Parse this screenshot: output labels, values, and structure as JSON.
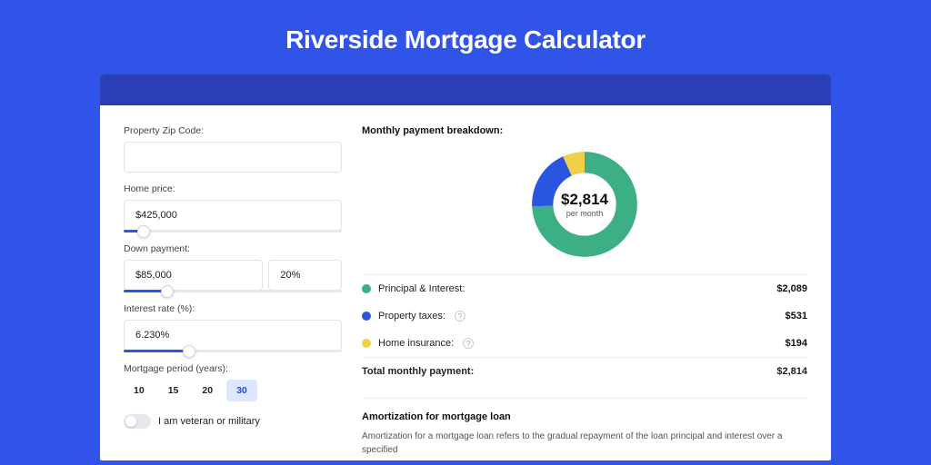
{
  "title": "Riverside Mortgage Calculator",
  "form": {
    "zip": {
      "label": "Property Zip Code:",
      "value": ""
    },
    "home_price": {
      "label": "Home price:",
      "value": "$425,000",
      "slider_pct": 9
    },
    "down_payment": {
      "label": "Down payment:",
      "amount": "$85,000",
      "percent": "20%",
      "slider_pct": 20
    },
    "interest": {
      "label": "Interest rate (%):",
      "value": "6.230%",
      "slider_pct": 30
    },
    "period": {
      "label": "Mortgage period (years):",
      "options": [
        "10",
        "15",
        "20",
        "30"
      ],
      "selected": "30"
    },
    "veteran": {
      "label": "I am veteran or military",
      "value": false
    }
  },
  "breakdown": {
    "title": "Monthly payment breakdown:",
    "center_amount": "$2,814",
    "center_sub": "per month",
    "items": [
      {
        "label": "Principal & Interest:",
        "value": "$2,089",
        "color": "g",
        "info": false
      },
      {
        "label": "Property taxes:",
        "value": "$531",
        "color": "b",
        "info": true
      },
      {
        "label": "Home insurance:",
        "value": "$194",
        "color": "y",
        "info": true
      }
    ],
    "total_label": "Total monthly payment:",
    "total_value": "$2,814"
  },
  "amort": {
    "title": "Amortization for mortgage loan",
    "text": "Amortization for a mortgage loan refers to the gradual repayment of the loan principal and interest over a specified"
  },
  "chart_data": {
    "type": "pie",
    "title": "Monthly payment breakdown",
    "series": [
      {
        "name": "Principal & Interest",
        "value": 2089,
        "color": "#3caf85"
      },
      {
        "name": "Property taxes",
        "value": 531,
        "color": "#2a55e0"
      },
      {
        "name": "Home insurance",
        "value": 194,
        "color": "#f2cf4a"
      }
    ],
    "total": 2814,
    "center_label": "$2,814 per month"
  }
}
